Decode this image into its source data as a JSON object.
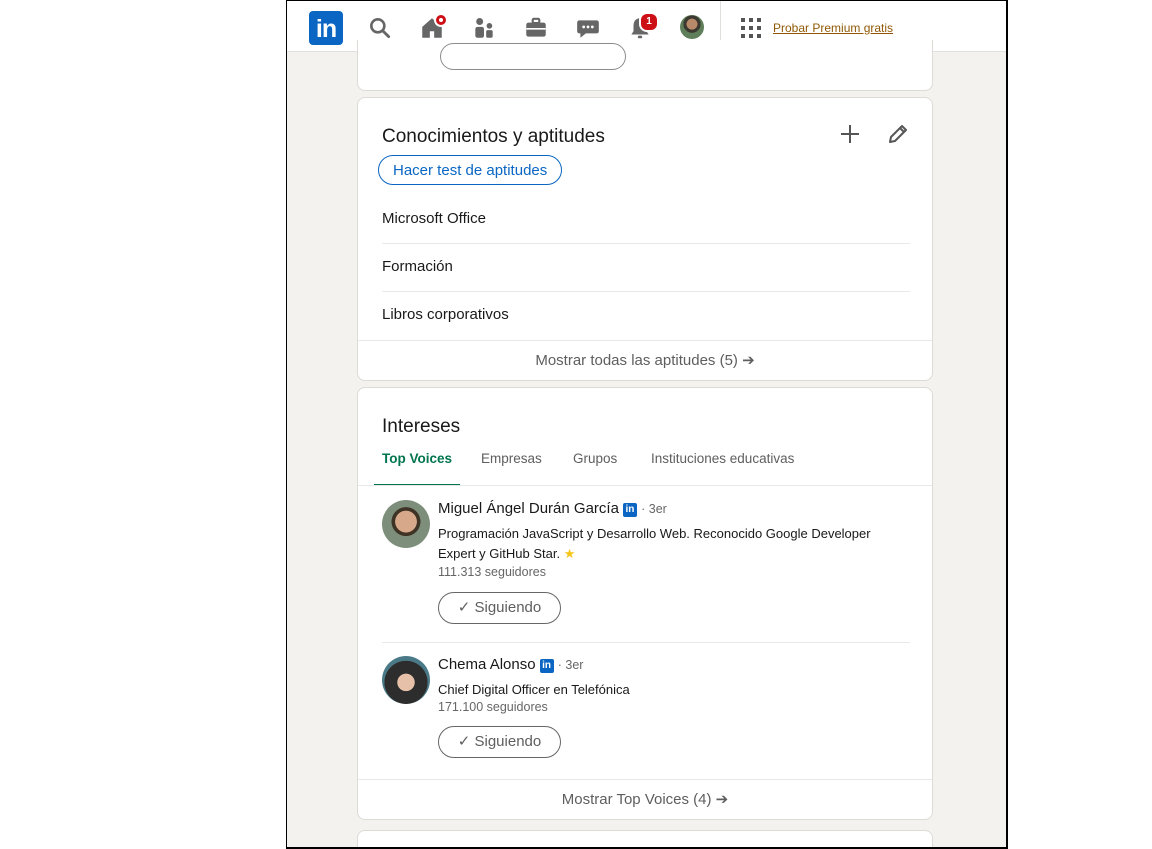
{
  "nav": {
    "logo_text": "in",
    "home_badge": "",
    "notifications_badge": "1",
    "premium_link": "Probar Premium gratis"
  },
  "skills": {
    "title": "Conocimientos y aptitudes",
    "test_button": "Hacer test de aptitudes",
    "items": [
      {
        "label": "Microsoft Office"
      },
      {
        "label": "Formación"
      },
      {
        "label": "Libros corporativos"
      }
    ],
    "show_all": "Mostrar todas las aptitudes (5) ➔"
  },
  "interests": {
    "title": "Intereses",
    "tabs": [
      {
        "label": "Top Voices",
        "active": true
      },
      {
        "label": "Empresas"
      },
      {
        "label": "Grupos"
      },
      {
        "label": "Instituciones educativas"
      }
    ],
    "voices": [
      {
        "name": "Miguel Ángel Durán García",
        "badge": "in",
        "degree": "· 3er",
        "description": "Programación JavaScript y Desarrollo Web. Reconocido Google Developer Expert y GitHub Star.",
        "star": "★",
        "followers": "111.313 seguidores",
        "follow_label": "✓ Siguiendo"
      },
      {
        "name": "Chema Alonso",
        "badge": "in",
        "degree": "· 3er",
        "description": "Chief Digital Officer en Telefónica",
        "followers": "171.100 seguidores",
        "follow_label": "✓ Siguiendo"
      }
    ],
    "show_all": "Mostrar Top Voices (4) ➔"
  },
  "colors": {
    "brand_blue": "#0a66c2",
    "active_green": "#01754f",
    "badge_red": "#cc1016",
    "page_bg": "#f3f2ef"
  }
}
